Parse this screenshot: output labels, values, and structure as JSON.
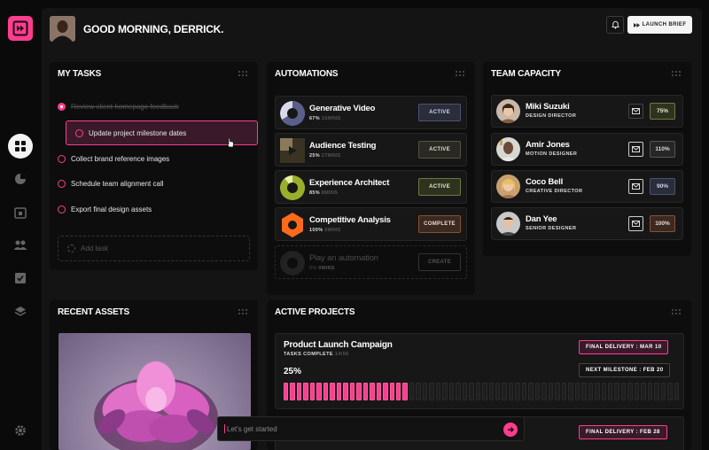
{
  "header": {
    "greeting": "GOOD MORNING, DERRICK.",
    "launch_label": "LAUNCH BRIEF"
  },
  "tasks": {
    "title": "MY TASKS",
    "items": [
      {
        "label": "Review client homepage feedback",
        "state": "done"
      },
      {
        "label": "Update project milestone dates",
        "state": "highlighted"
      },
      {
        "label": "Collect brand reference images",
        "state": "open"
      },
      {
        "label": "Schedule team alignment call",
        "state": "open"
      },
      {
        "label": "Export final design assets",
        "state": "open"
      }
    ],
    "add_label": "Add task"
  },
  "automations": {
    "title": "AUTOMATIONS",
    "items": [
      {
        "name": "Generative Video",
        "pct": "67%",
        "time": "15MINS",
        "status": "ACTIVE"
      },
      {
        "name": "Audience Testing",
        "pct": "25%",
        "time": "27MINS",
        "status": "ACTIVE"
      },
      {
        "name": "Experience Architect",
        "pct": "85%",
        "time": "8MINS",
        "status": "ACTIVE"
      },
      {
        "name": "Competitive Analysis",
        "pct": "100%",
        "time": "0MINS",
        "status": "COMPLETE"
      },
      {
        "name": "Play an automation",
        "pct": "0%",
        "time": "0MINS",
        "status": "CREATE"
      }
    ]
  },
  "team": {
    "title": "TEAM CAPACITY",
    "members": [
      {
        "name": "Miki Suzuki",
        "role": "DESIGN DIRECTOR",
        "capacity": "75%"
      },
      {
        "name": "Amir Jones",
        "role": "MOTION DESIGNER",
        "capacity": "110%"
      },
      {
        "name": "Coco Bell",
        "role": "CREATIVE DIRECTOR",
        "capacity": "90%"
      },
      {
        "name": "Dan Yee",
        "role": "SENIOR DESIGNER",
        "capacity": "100%"
      }
    ]
  },
  "assets": {
    "title": "RECENT ASSETS"
  },
  "projects": {
    "title": "ACTIVE PROJECTS",
    "items": [
      {
        "name": "Product Launch Campaign",
        "tasks_label": "TASKS COMPLETE",
        "tasks_count": "14/56",
        "progress": "25%",
        "progress_fraction": 0.25,
        "final_delivery": "FINAL DELIVERY : MAR 10",
        "next_milestone": "NEXT MILESTONE : FEB 20"
      },
      {
        "final_delivery": "FINAL DELIVERY : FEB 28"
      }
    ]
  },
  "chat": {
    "placeholder": "Let's get started"
  },
  "colors": {
    "accent": "#ff3d8f",
    "background": "#0a0a0a",
    "panel": "#0d0d0d"
  }
}
